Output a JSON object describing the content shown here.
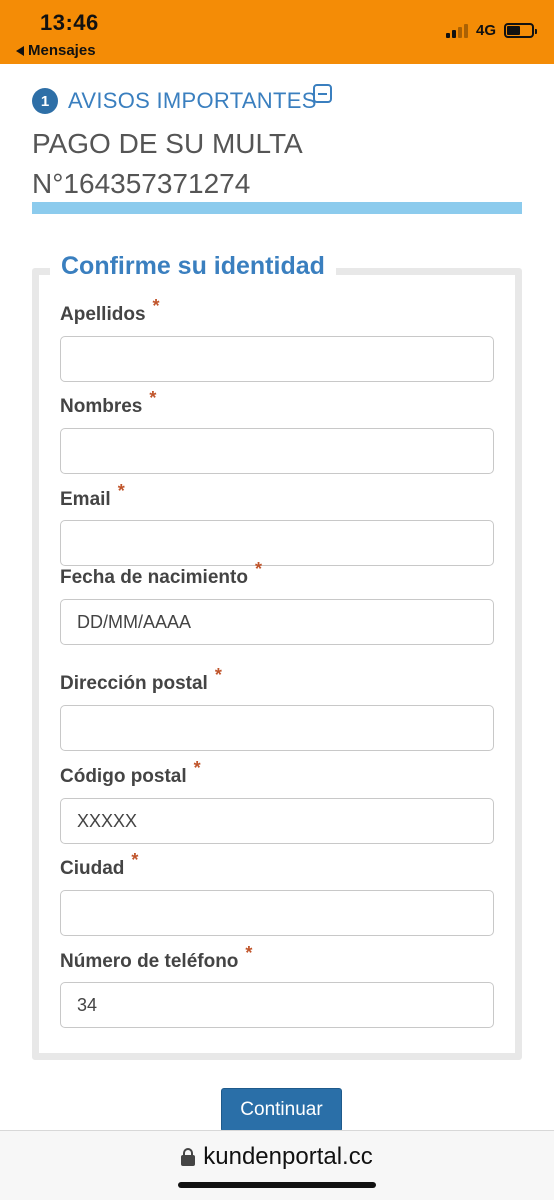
{
  "status_bar": {
    "time": "13:46",
    "back_label": "Mensajes",
    "network": "4G",
    "signal_bars_active": 2,
    "battery_level": 0.55
  },
  "notices": {
    "count": "1",
    "title": "AVISOS IMPORTANTES"
  },
  "fine": {
    "line1": "PAGO DE SU MULTA",
    "line2": "N°164357371274"
  },
  "form": {
    "legend": "Confirme su identidad",
    "required_marker": "*",
    "fields": [
      {
        "label": "Apellidos",
        "value": ""
      },
      {
        "label": "Nombres",
        "value": ""
      },
      {
        "label": "Email",
        "value": ""
      },
      {
        "label": "Fecha de nacimiento",
        "value": "DD/MM/AAAA"
      },
      {
        "label": "Dirección postal",
        "value": ""
      },
      {
        "label": "Código postal",
        "value": "XXXXX"
      },
      {
        "label": "Ciudad",
        "value": ""
      },
      {
        "label": "Número de teléfono",
        "value": "34"
      }
    ],
    "submit_label": "Continuar"
  },
  "url_bar": {
    "domain": "kundenportal.cc"
  },
  "colors": {
    "status_bar": "#f48c06",
    "accent_blue": "#3a7fbf",
    "button_blue": "#2a6fa8",
    "rule_light_blue": "#8ccbed",
    "required_star": "#c0542a"
  }
}
